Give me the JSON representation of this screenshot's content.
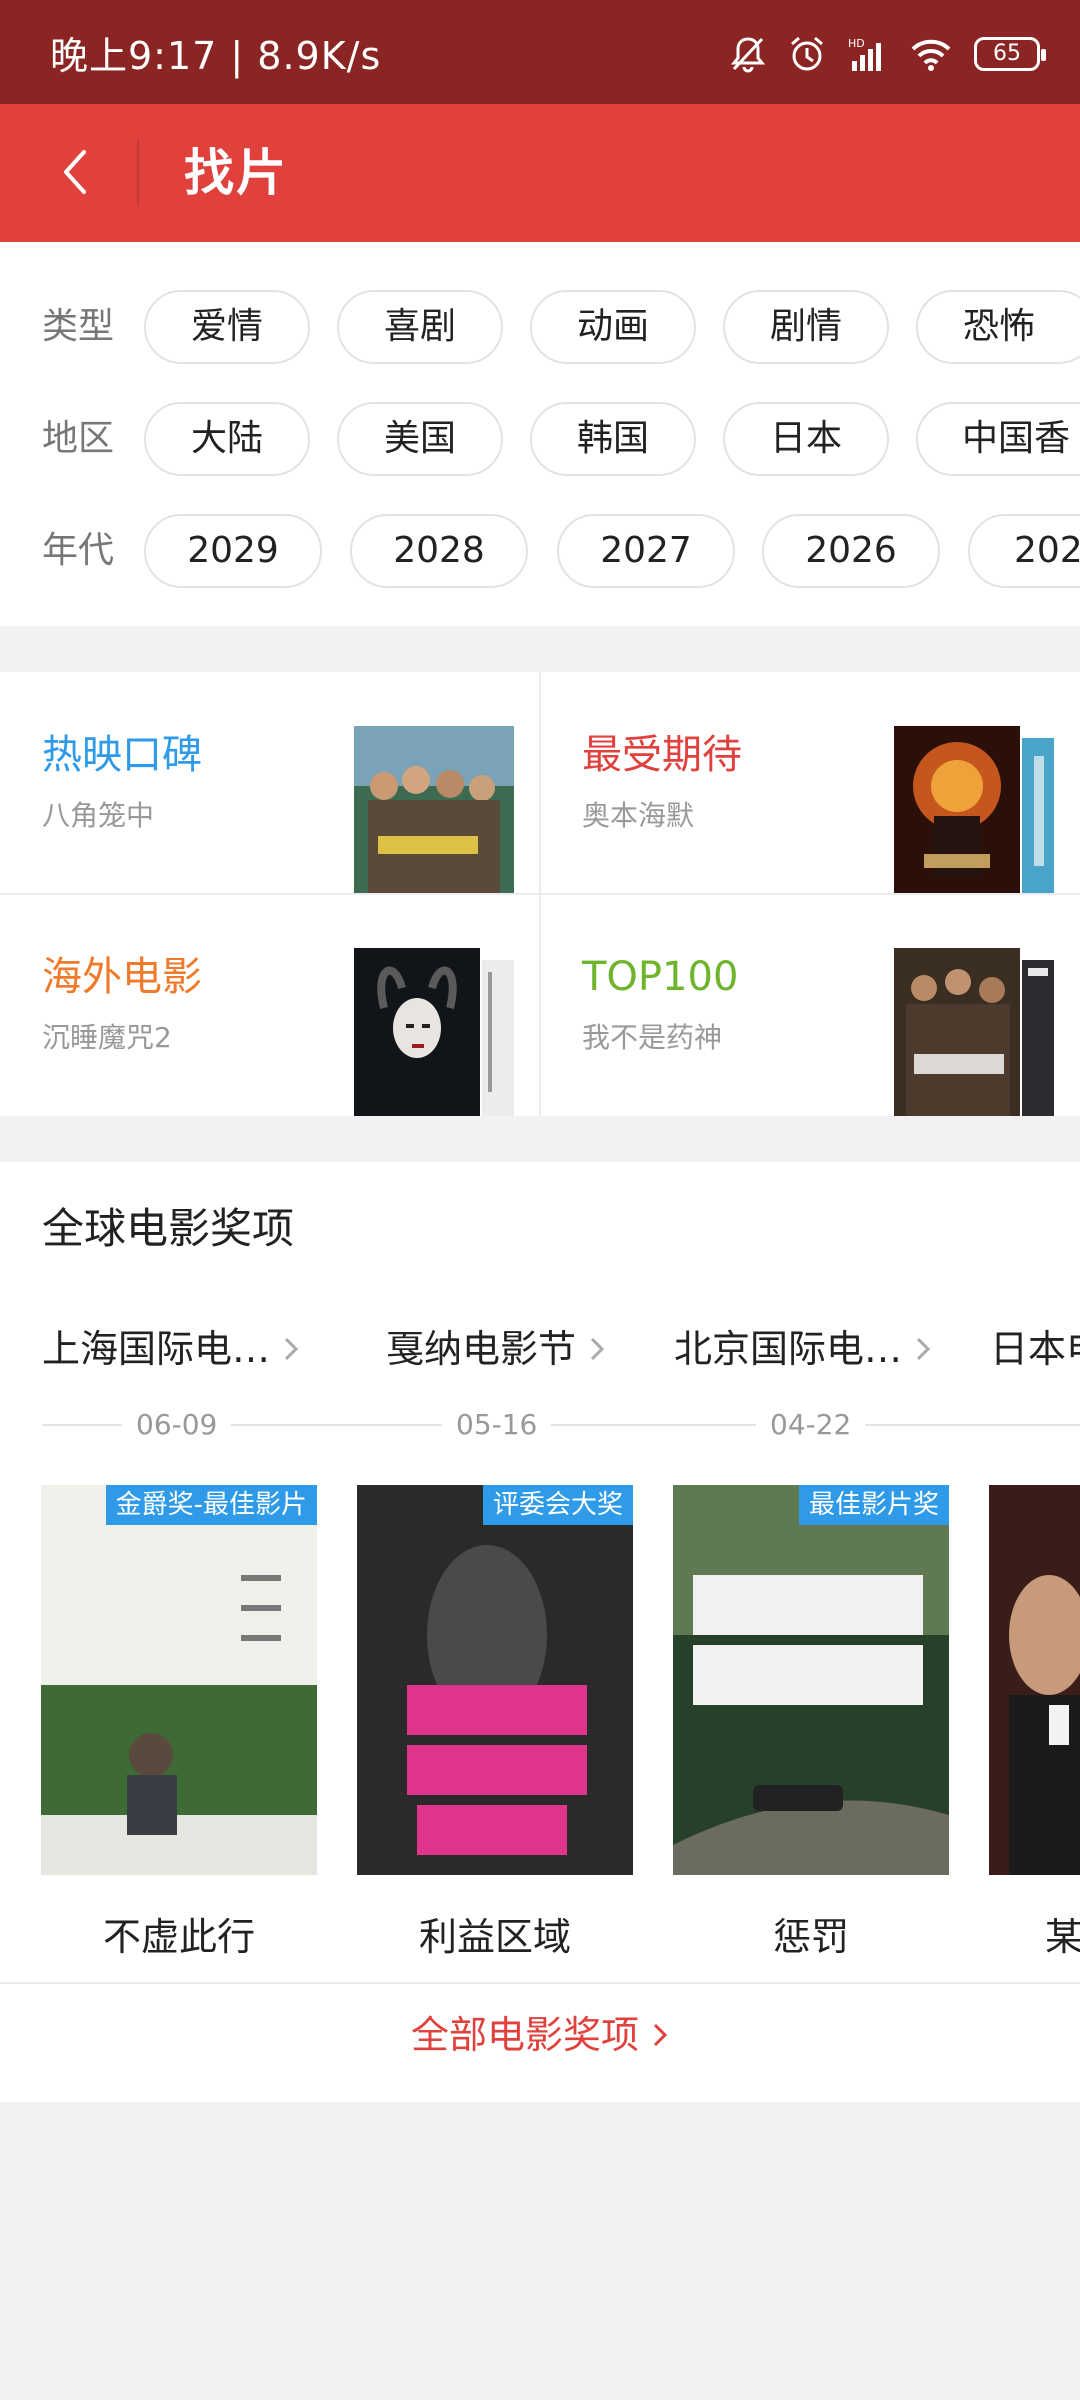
{
  "status_bar": {
    "time": "晚上9:17 | 8.9K/s",
    "battery": "65"
  },
  "header": {
    "title": "找片"
  },
  "filters": {
    "type": {
      "label": "类型",
      "options": [
        "爱情",
        "喜剧",
        "动画",
        "剧情",
        "恐怖"
      ]
    },
    "region": {
      "label": "地区",
      "options": [
        "大陆",
        "美国",
        "韩国",
        "日本",
        "中国香"
      ]
    },
    "year": {
      "label": "年代",
      "options": [
        "2029",
        "2028",
        "2027",
        "2026",
        "202"
      ]
    }
  },
  "categories": [
    {
      "name": "热映口碑",
      "sub": "八角笼中",
      "color": "#2f9be8"
    },
    {
      "name": "最受期待",
      "sub": "奥本海默",
      "color": "#e0413d"
    },
    {
      "name": "海外电影",
      "sub": "沉睡魔咒2",
      "color": "#f07a2a"
    },
    {
      "name": "TOP100",
      "sub": "我不是药神",
      "color": "#6fb52c"
    }
  ],
  "awards": {
    "heading": "全球电影奖项",
    "festivals": [
      "上海国际电…",
      "戛纳电影节",
      "北京国际电…",
      "日本电"
    ],
    "dates": [
      "06-09",
      "05-16",
      "04-22"
    ],
    "films": [
      {
        "badge": "金爵奖-最佳影片",
        "title": "不虚此行"
      },
      {
        "badge": "评委会大奖",
        "title": "利益区域"
      },
      {
        "badge": "最佳影片奖",
        "title": "惩罚"
      },
      {
        "badge": "",
        "title": "某"
      }
    ],
    "more": "全部电影奖项"
  },
  "colors": {
    "status_bar": "#8a2524",
    "header": "#e0413d",
    "badge": "#2f9be8"
  }
}
